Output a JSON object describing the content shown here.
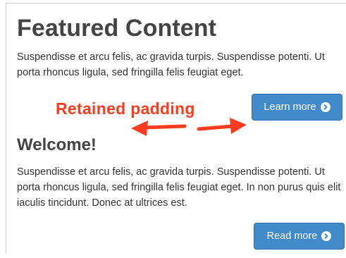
{
  "featured": {
    "title": "Featured Content",
    "body": "Suspendisse et arcu felis, ac gravida turpis. Suspendisse potenti. Ut porta rhoncus ligula, sed fringilla felis feugiat eget.",
    "button_label": "Learn more",
    "button_icon": "chevron-circle-right-icon"
  },
  "welcome": {
    "title": "Welcome!",
    "body": "Suspendisse et arcu felis, ac gravida turpis. Suspendisse potenti. Ut porta rhoncus ligula, sed fringilla felis feugiat eget. In non purus quis elit iaculis tincidunt. Donec at ultrices est.",
    "button_label": "Read more",
    "button_icon": "chevron-circle-right-icon"
  },
  "annotation": {
    "label": "Retained padding",
    "color": "#ff3b1f"
  },
  "colors": {
    "button_bg": "#428bca",
    "button_border": "#2f6faf",
    "heading": "#444444",
    "text": "#333333"
  }
}
